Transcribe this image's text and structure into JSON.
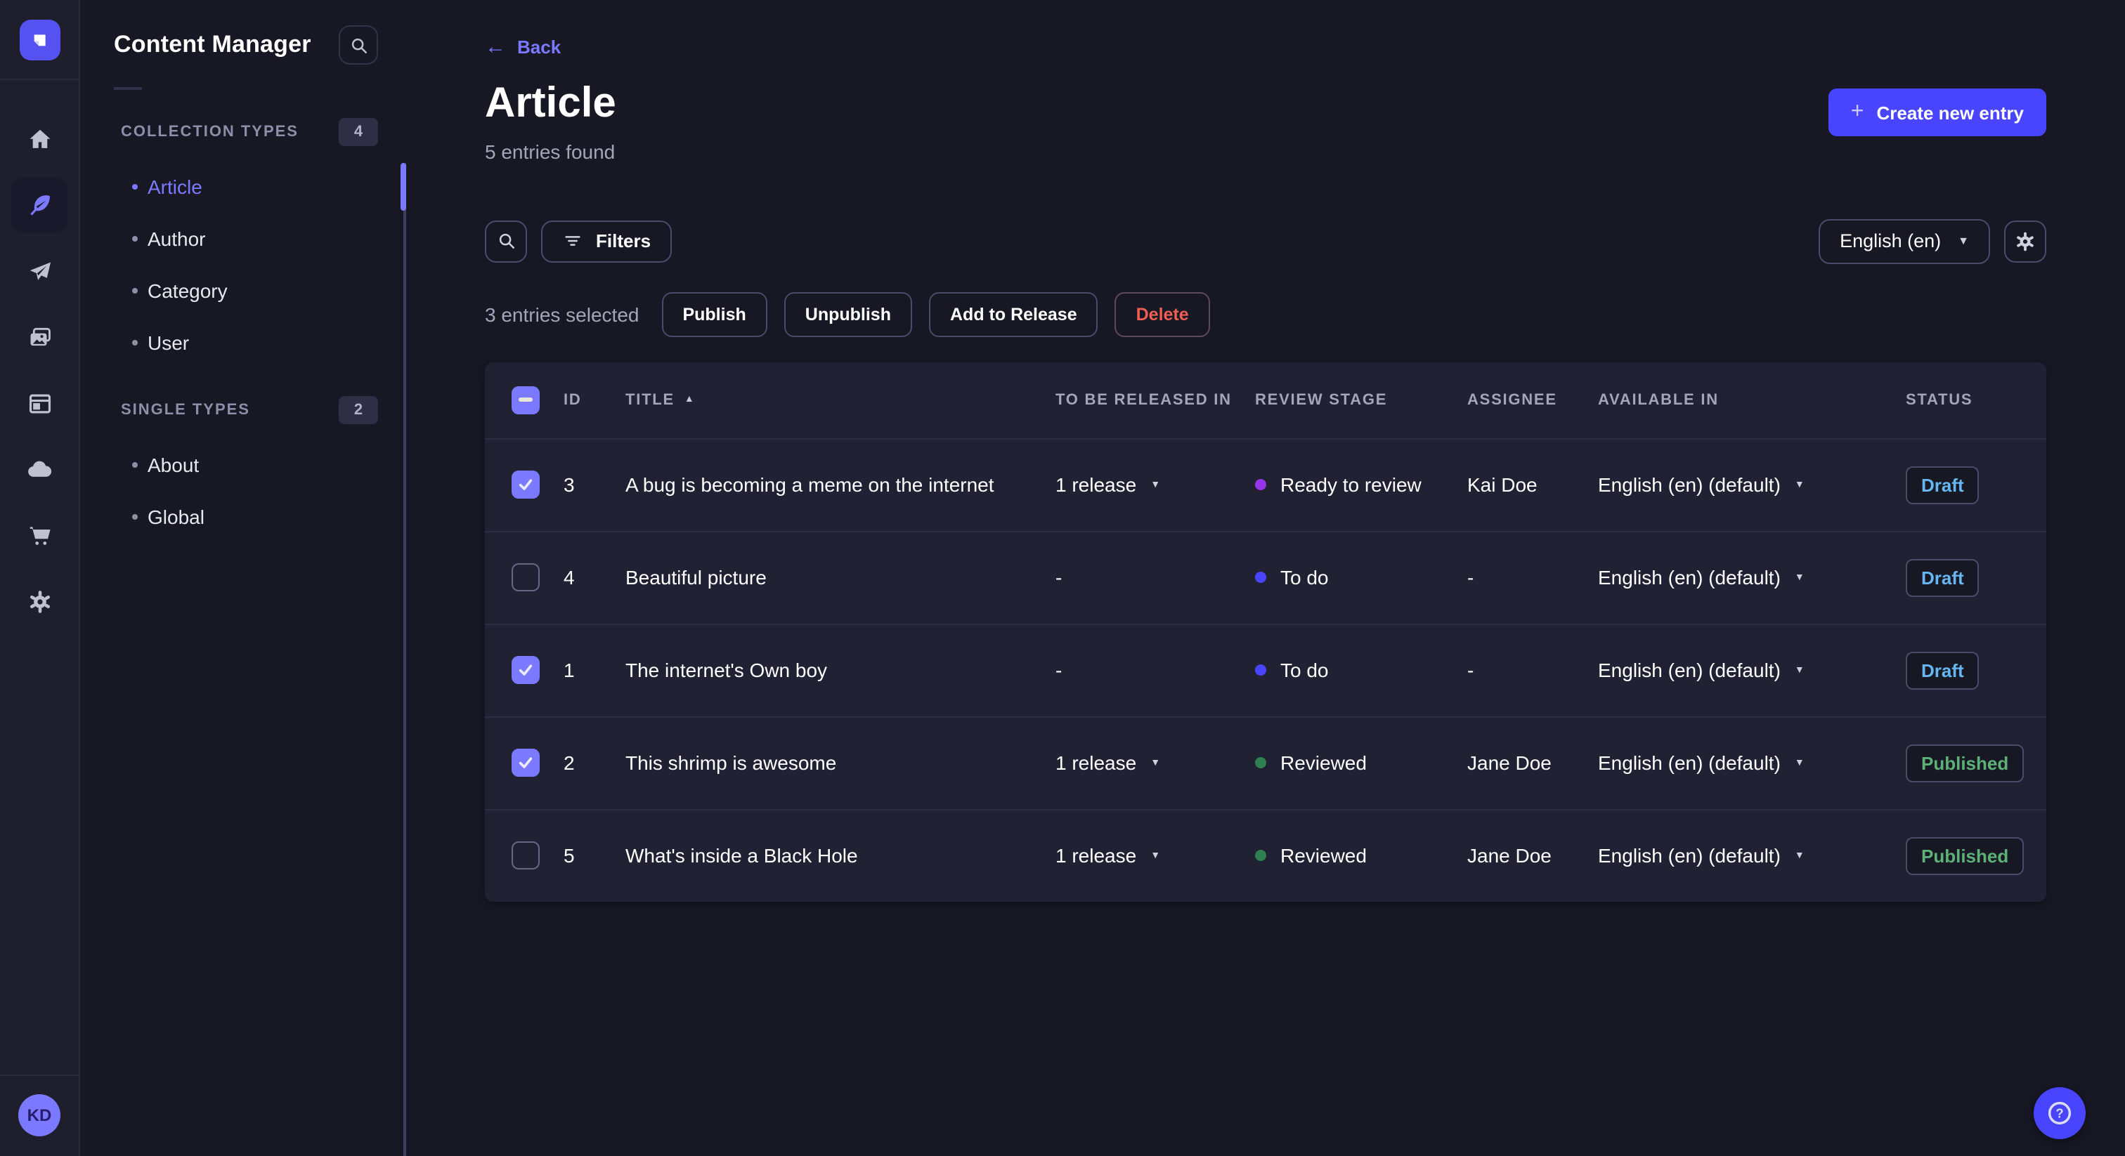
{
  "colors": {
    "primary": "#4945ff",
    "primary_light": "#7b79ff",
    "draft_text": "#66b7f1",
    "published_text": "#5cb176",
    "danger_text": "#ee5e52",
    "surface": "#212134",
    "background": "#181825"
  },
  "nav_rail": {
    "icons": [
      "home-icon",
      "feather-content-manager-icon",
      "paper-plane-icon",
      "images-media-library-icon",
      "layout-icon",
      "cloud-icon",
      "cart-icon",
      "gear-icon"
    ],
    "active_icon": "feather-content-manager-icon"
  },
  "user": {
    "initials": "KD"
  },
  "sidebar": {
    "title": "Content Manager",
    "sections": [
      {
        "label": "COLLECTION TYPES",
        "count": "4",
        "items": [
          {
            "label": "Article",
            "active": true
          },
          {
            "label": "Author",
            "active": false
          },
          {
            "label": "Category",
            "active": false
          },
          {
            "label": "User",
            "active": false
          }
        ]
      },
      {
        "label": "SINGLE TYPES",
        "count": "2",
        "items": [
          {
            "label": "About",
            "active": false
          },
          {
            "label": "Global",
            "active": false
          }
        ]
      }
    ]
  },
  "header": {
    "back_label": "Back",
    "title": "Article",
    "subtitle": "5 entries found",
    "create_button": "Create new entry"
  },
  "toolbar": {
    "filters_label": "Filters",
    "locale": "English (en)"
  },
  "selection": {
    "text": "3 entries selected",
    "actions": [
      "Publish",
      "Unpublish",
      "Add to Release",
      "Delete"
    ]
  },
  "table": {
    "columns": [
      "ID",
      "TITLE",
      "TO BE RELEASED IN",
      "REVIEW STAGE",
      "ASSIGNEE",
      "AVAILABLE IN",
      "STATUS"
    ],
    "sort_column": "TITLE",
    "sort_direction": "asc",
    "rows": [
      {
        "checked": true,
        "id": "3",
        "title": "A bug is becoming a meme on the internet",
        "released": "1 release",
        "review": "Ready to review",
        "review_color": "#9736e8",
        "assignee": "Kai Doe",
        "available": "English (en) (default)",
        "status": "Draft"
      },
      {
        "checked": false,
        "id": "4",
        "title": "Beautiful picture",
        "released": "-",
        "review": "To do",
        "review_color": "#4945ff",
        "assignee": "-",
        "available": "English (en) (default)",
        "status": "Draft"
      },
      {
        "checked": true,
        "id": "1",
        "title": "The internet's Own boy",
        "released": "-",
        "review": "To do",
        "review_color": "#4945ff",
        "assignee": "-",
        "available": "English (en) (default)",
        "status": "Draft"
      },
      {
        "checked": true,
        "id": "2",
        "title": "This shrimp is awesome",
        "released": "1 release",
        "review": "Reviewed",
        "review_color": "#2f8050",
        "assignee": "Jane Doe",
        "available": "English (en) (default)",
        "status": "Published"
      },
      {
        "checked": false,
        "id": "5",
        "title": "What's inside a Black Hole",
        "released": "1 release",
        "review": "Reviewed",
        "review_color": "#2f8050",
        "assignee": "Jane Doe",
        "available": "English (en) (default)",
        "status": "Published"
      }
    ]
  }
}
